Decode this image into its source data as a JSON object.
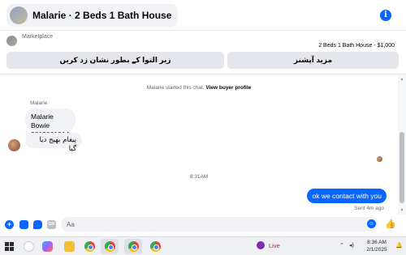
{
  "header": {
    "title": "Malarie · 2 Beds 1 Bath House",
    "info_icon": "info-icon"
  },
  "marketplace": {
    "label": "Marketplace",
    "listing": "2 Beds 1 Bath House - $1,000",
    "mark_sold_button": "زیر التوا کے بطور نشان زد کریں",
    "more_options_button": "مزید آپشنز"
  },
  "chat": {
    "system_note": "Malarie started this chat.",
    "view_profile_link": "View buyer profile",
    "sender_name": "Malarie",
    "incoming": [
      {
        "line1": "Malarie Bowie",
        "line2": "2813801914"
      },
      {
        "text": "پیغام بھیج دیا گیا"
      }
    ],
    "timestamp": "8:31AM",
    "outgoing_text": "ok we contact with you",
    "sent_status": "Sent 4m ago"
  },
  "composer": {
    "placeholder": "Aa"
  },
  "taskbar": {
    "live_label": "Live",
    "time": "8:36 AM",
    "date": "2/1/2025"
  },
  "colors": {
    "accent": "#0866ff",
    "bubble_in": "#f0f2f5",
    "button_bg": "#e4e6eb"
  }
}
